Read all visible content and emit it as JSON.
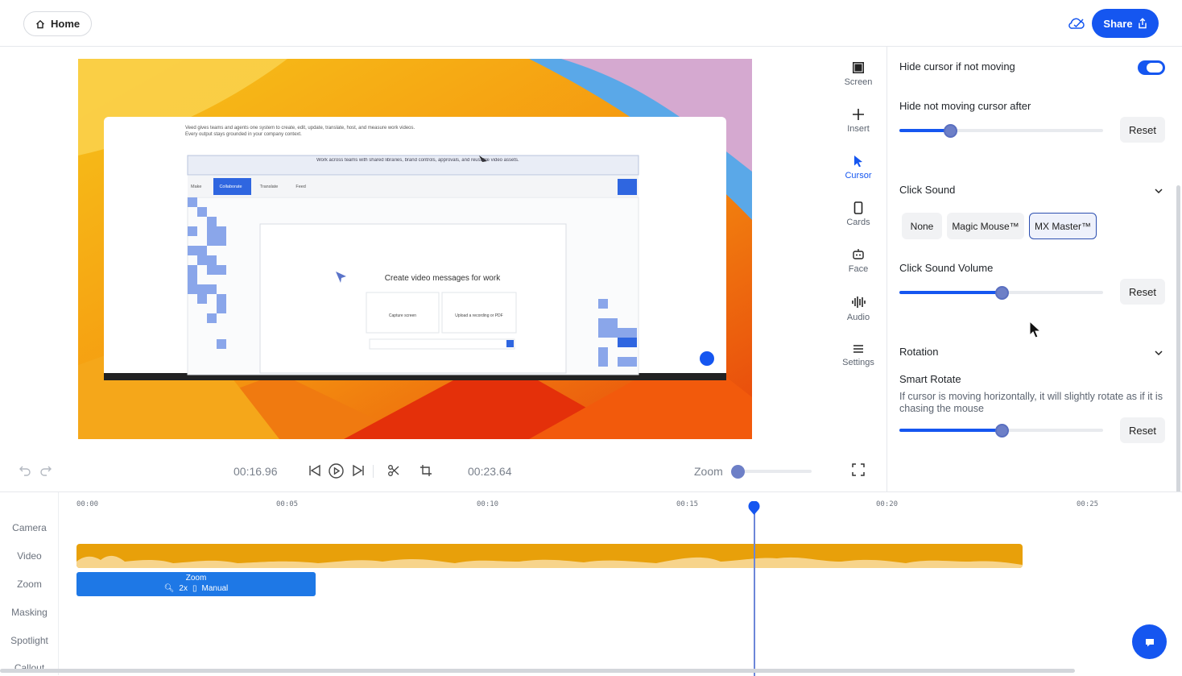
{
  "header": {
    "home_label": "Home",
    "share_label": "Share",
    "cloud_icon": "cloud-check-icon",
    "share_icon": "share-icon",
    "brand_color": "#1556f0"
  },
  "preview": {
    "inner_caption": "Create video messages for work",
    "inner_banner": "Work across teams with shared libraries, brand controls, approvals, and reusable video assets.",
    "inner_tabs": [
      "Make",
      "Collaborate",
      "Translate",
      "Feed"
    ],
    "inner_intro": "Veed gives teams and agents one system to create, edit, update, translate, host, and measure work videos. Every output stays grounded in your company context.",
    "inner_card_left": "Capture screen",
    "inner_card_right": "Upload a recording or PDF"
  },
  "tools": [
    {
      "label": "Screen",
      "icon": "screen-icon",
      "active": false
    },
    {
      "label": "Insert",
      "icon": "plus-icon",
      "active": false
    },
    {
      "label": "Cursor",
      "icon": "cursor-icon",
      "active": true
    },
    {
      "label": "Cards",
      "icon": "card-icon",
      "active": false
    },
    {
      "label": "Face",
      "icon": "face-icon",
      "active": false
    },
    {
      "label": "Audio",
      "icon": "audio-icon",
      "active": false
    },
    {
      "label": "Settings",
      "icon": "settings-icon",
      "active": false
    }
  ],
  "panel": {
    "hide_cursor_label": "Hide cursor if not moving",
    "hide_cursor_on": true,
    "hide_after_label": "Hide not moving cursor after",
    "hide_after_level": 0.25,
    "reset_label": "Reset",
    "click_sound_label": "Click Sound",
    "click_sound_options": [
      "None",
      "Magic Mouse™",
      "MX Master™"
    ],
    "click_sound_selected": "MX Master™",
    "click_volume_label": "Click Sound Volume",
    "click_volume_level": 0.5,
    "rotation_label": "Rotation",
    "smart_rotate_label": "Smart Rotate",
    "smart_rotate_desc": "If cursor is moving horizontally, it will slightly rotate as if it is chasing the mouse",
    "smart_rotate_level": 0.5
  },
  "controls": {
    "current_time": "00:16.96",
    "total_time": "00:23.64",
    "zoom_label": "Zoom",
    "zoom_level": 0.0
  },
  "timeline": {
    "tracks": [
      "Camera",
      "Video",
      "Zoom",
      "Masking",
      "Spotlight",
      "Callout"
    ],
    "ticks": [
      "00:00",
      "00:05",
      "00:10",
      "00:15",
      "00:20",
      "00:25"
    ],
    "zoom_clip_title": "Zoom",
    "zoom_clip_scale": "2x",
    "zoom_clip_mode": "Manual",
    "video_color": "#e8a00a",
    "zoom_color": "#1e78e6"
  }
}
